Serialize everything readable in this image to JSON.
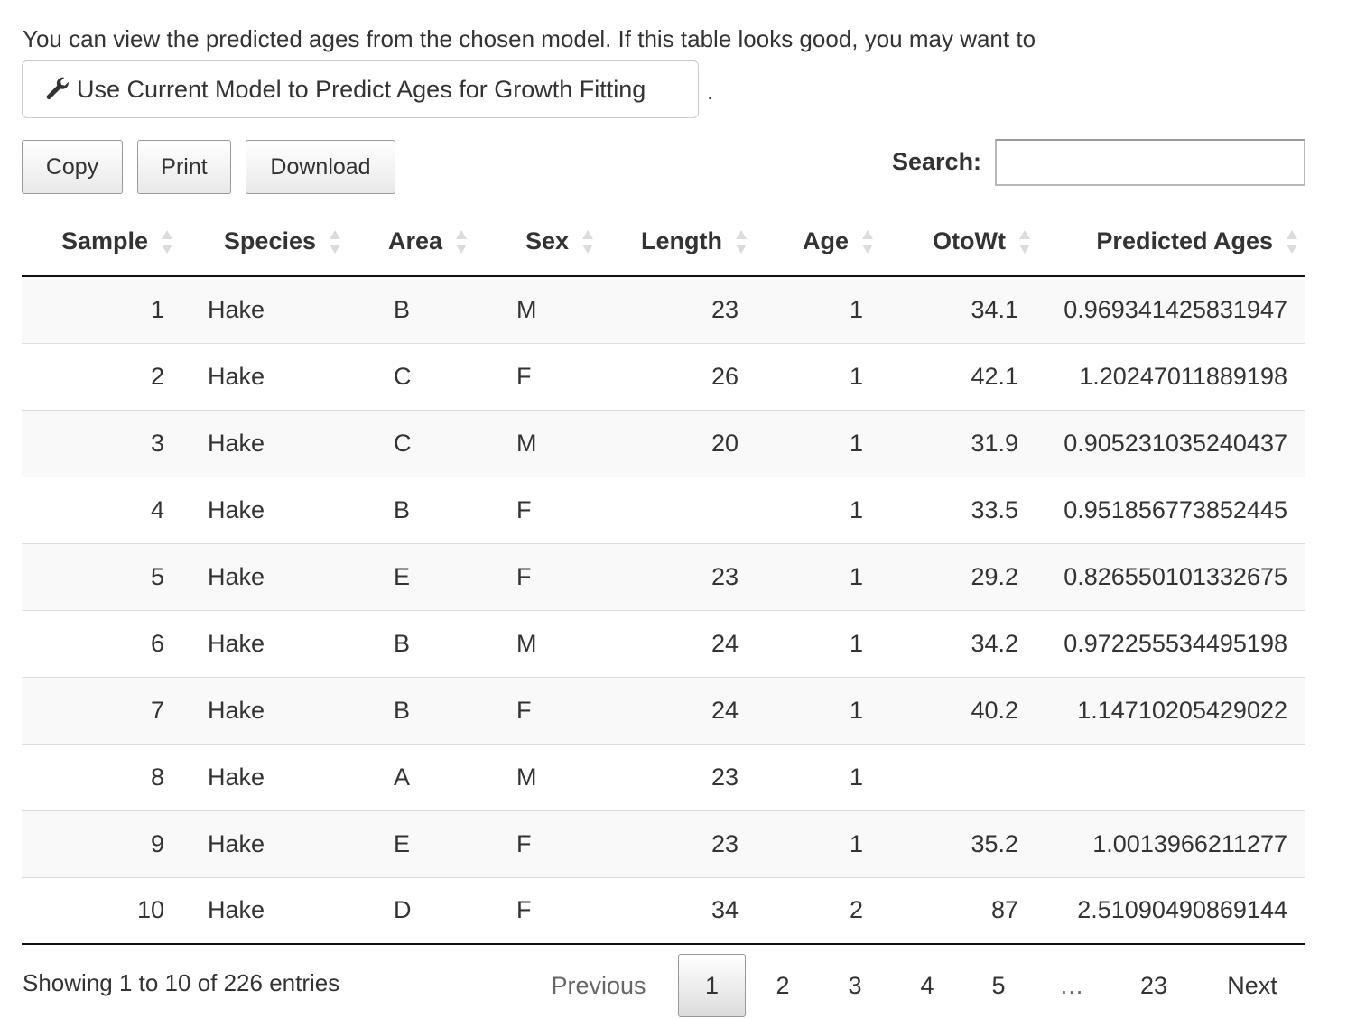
{
  "intro_text": "You can view the predicted ages from the chosen model. If this table looks good, you may want to",
  "action_button": {
    "label": "Use Current Model to Predict Ages for Growth Fitting",
    "icon": "wrench-icon"
  },
  "trailing_dot": ".",
  "toolbar": {
    "copy_label": "Copy",
    "print_label": "Print",
    "download_label": "Download"
  },
  "search": {
    "label": "Search:",
    "value": ""
  },
  "table": {
    "columns": [
      "Sample",
      "Species",
      "Area",
      "Sex",
      "Length",
      "Age",
      "OtoWt",
      "Predicted Ages"
    ],
    "rows": [
      [
        "1",
        "Hake",
        "B",
        "M",
        "23",
        "1",
        "34.1",
        "0.969341425831947"
      ],
      [
        "2",
        "Hake",
        "C",
        "F",
        "26",
        "1",
        "42.1",
        "1.20247011889198"
      ],
      [
        "3",
        "Hake",
        "C",
        "M",
        "20",
        "1",
        "31.9",
        "0.905231035240437"
      ],
      [
        "4",
        "Hake",
        "B",
        "F",
        "",
        "1",
        "33.5",
        "0.951856773852445"
      ],
      [
        "5",
        "Hake",
        "E",
        "F",
        "23",
        "1",
        "29.2",
        "0.826550101332675"
      ],
      [
        "6",
        "Hake",
        "B",
        "M",
        "24",
        "1",
        "34.2",
        "0.972255534495198"
      ],
      [
        "7",
        "Hake",
        "B",
        "F",
        "24",
        "1",
        "40.2",
        "1.14710205429022"
      ],
      [
        "8",
        "Hake",
        "A",
        "M",
        "23",
        "1",
        "",
        ""
      ],
      [
        "9",
        "Hake",
        "E",
        "F",
        "23",
        "1",
        "35.2",
        "1.0013966211277"
      ],
      [
        "10",
        "Hake",
        "D",
        "F",
        "34",
        "2",
        "87",
        "2.51090490869144"
      ]
    ]
  },
  "info_text": "Showing 1 to 10 of 226 entries",
  "pagination": {
    "previous": "Previous",
    "pages": [
      "1",
      "2",
      "3",
      "4",
      "5",
      "…",
      "23"
    ],
    "current": "1",
    "next": "Next"
  },
  "colors": {
    "stripe": "#f9f9f9",
    "border": "#dddddd",
    "text": "#333333"
  }
}
